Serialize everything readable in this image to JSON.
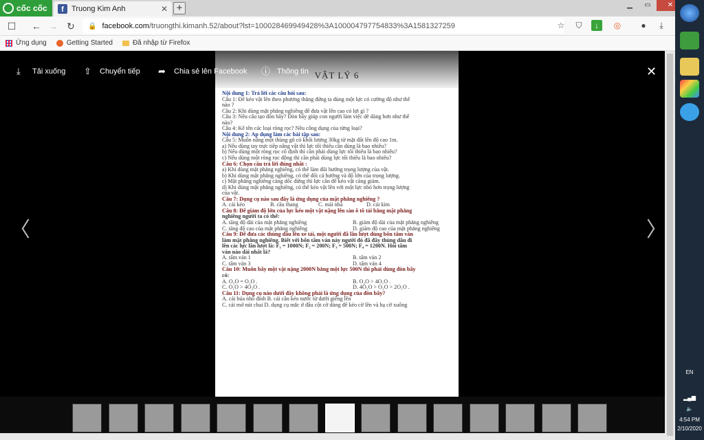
{
  "browser": {
    "brand_label": "cốc cốc",
    "tab_title": "Truong Kim Anh",
    "tab_close": "✕",
    "new_tab": "+",
    "url_host": "facebook.com",
    "url_path": "/truongthi.kimanh.52/about?lst=100028469949428%3A100004797754833%3A1581327259",
    "bookmarks": [
      "Ứng dụng",
      "Getting Started",
      "Đã nhập từ Firefox"
    ]
  },
  "viewer": {
    "toolbar": [
      "Tải xuống",
      "Chuyển tiếp",
      "Chia sẻ lên Facebook",
      "Thông tin"
    ],
    "close": "✕",
    "prev": "〈",
    "next": "〉",
    "thumbnail_count": 15,
    "active_thumbnail_index": 7
  },
  "document": {
    "title": "VẬT LÝ 6",
    "lines": [
      {
        "cls": "h",
        "text": "Nội dung 1: Trả lời các câu hỏi sau:"
      },
      {
        "cls": "",
        "text": "Câu 1: Để kéo vật lên theo phương thẳng đứng ta dùng một lực có cường độ như thế"
      },
      {
        "cls": "",
        "text": "nào ?"
      },
      {
        "cls": "",
        "text": "Câu 2: Khi dùng mặt phẳng nghiêng để đưa vật lên cao có lợi gì ?"
      },
      {
        "cls": "",
        "text": "Câu 3: Nêu cấu tạo đòn bẩy? Đòn bẩy giúp con người làm việc dễ dàng hơn như thế"
      },
      {
        "cls": "",
        "text": "nào?"
      },
      {
        "cls": "",
        "text": "Câu 4: Kể tên các loại ròng rọc? Nêu công dụng của từng loại?"
      },
      {
        "cls": "h",
        "text": "Nội dung 2: Áp dụng làm các bài tập sau:"
      },
      {
        "cls": "",
        "text": "Câu 5: Muốn nâng một thùng gỗ có khối lượng 30kg từ mặt đất lên độ cao 1m."
      },
      {
        "cls": "",
        "text": "a) Nếu dùng tay trực tiếp nâng vật thì lực tối thiểu cần dùng là bao nhiêu?"
      },
      {
        "cls": "",
        "text": "b) Nếu dùng một ròng rọc cố định thì cần phải dùng lực tối thiểu là bao nhiêu?"
      },
      {
        "cls": "",
        "text": "c) Nếu dùng một ròng rọc động thì cần phải dùng lực tối thiểu là bao nhiêu?"
      },
      {
        "cls": "q",
        "text": "Câu 6: Chọn câu trả lời đúng nhất :"
      },
      {
        "cls": "",
        "text": "a) Khi dùng mặt phẳng nghiêng, có thể làm đổi hướng trọng lượng của vật."
      },
      {
        "cls": "",
        "text": "b) Khi dùng mặt phẳng nghiêng, có thể đổi cả hướng và độ lớn của trọng lượng."
      },
      {
        "cls": "",
        "text": "c) Mặt phẳng nghiêng càng dốc đứng thì lực cần để kéo vật càng giảm."
      },
      {
        "cls": "",
        "text": "d) Khi dùng mặt phẳng nghiêng, có thể kéo vật lên với một lực nhỏ hơn trọng lượng"
      },
      {
        "cls": "",
        "text": "của vật."
      },
      {
        "cls": "q",
        "text": "Câu 7: Dụng cụ nào sau đây là ứng dụng của mặt phẳng nghiêng ?"
      },
      {
        "cls": "opt4",
        "cols": [
          "A. cái kéo",
          "B. cầu thang",
          "C. mái nhà",
          "D. cái kìm"
        ]
      },
      {
        "cls": "q",
        "text": "Câu 8: Để giảm độ lớn của lực kéo một vật nặng lên sàn ô tô tải bằng mặt phẳng"
      },
      {
        "cls": "b",
        "text": "nghiêng người ta có thể:"
      },
      {
        "cls": "opt2",
        "cols": [
          "A. tăng độ dài của mặt phẳng nghiêng",
          "B. giảm độ dài của mặt phẳng nghiêng"
        ]
      },
      {
        "cls": "opt2",
        "cols": [
          "C. tăng độ cao của mặt phẳng nghiêng",
          "D. giảm độ cao của mặt phẳng nghiêng"
        ]
      },
      {
        "cls": "q",
        "text": "Câu 9: Để đưa các thùng dầu lên xe tải, một người đã lần lượt dùng bốn tấm ván"
      },
      {
        "cls": "b",
        "text": "làm mặt phẳng nghiêng. Biết với bốn tấm ván này người đó đã đẩy thùng dầu đi"
      },
      {
        "cls": "b",
        "text": "lên các lực lần lượt là: F₁ = 1000N; F₂ = 200N; F₃ = 500N; F₄ = 1200N. Hỏi tấm"
      },
      {
        "cls": "b",
        "text": "ván nào dài nhất là?"
      },
      {
        "cls": "opt2",
        "cols": [
          "A. tấm ván 1",
          "B. tấm ván 2"
        ]
      },
      {
        "cls": "opt2",
        "cols": [
          "C. tấm ván 3",
          "D. tấm ván 4"
        ]
      },
      {
        "cls": "q",
        "text": "Câu 10: Muốn bẩy một vật nặng 2000N bằng một lực 500N thì phải dùng đòn bẩy"
      },
      {
        "cls": "b",
        "text": "có:"
      },
      {
        "cls": "opt2",
        "cols": [
          "  A.   O₂O = O₁O .",
          "B.   O₂O > 4O₁O ."
        ]
      },
      {
        "cls": "opt2",
        "cols": [
          "  C.   O₁O > 4O₂O .",
          "D.   4O₁O > O₂O > 2O₁O ."
        ]
      },
      {
        "cls": "q",
        "text": "Câu 11: Dụng cụ nào dưới đây không phải là ứng dụng của đòn bẩy?"
      },
      {
        "cls": "",
        "text": "A. cái búa nhổ đinh    B. cái cần kéo nước từ dưới giếng lên"
      },
      {
        "cls": "",
        "text": "C. cái mở nút chai     D. dụng cụ mắc ở đầu cột cờ dùng để kéo cờ lên và hạ cờ xuống"
      }
    ]
  },
  "taskbar": {
    "language": "EN",
    "time": "4:54 PM",
    "date": "2/10/2020"
  }
}
